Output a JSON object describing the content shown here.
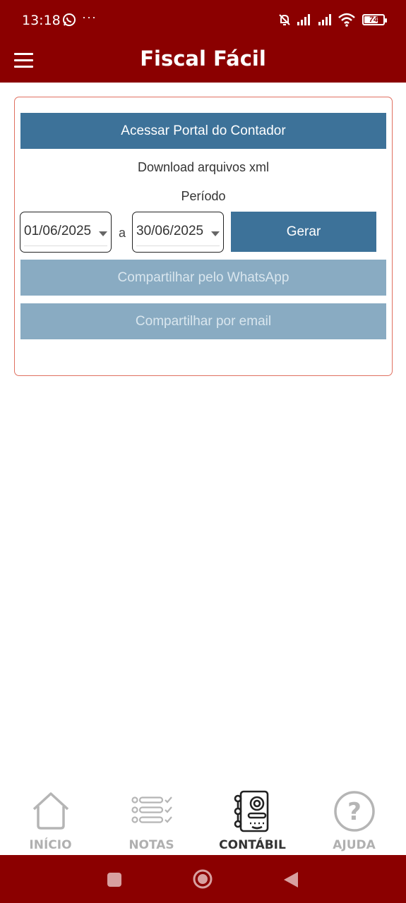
{
  "status_bar": {
    "time": "13:18",
    "dots": "···",
    "battery_level": 74,
    "battery_text": "74",
    "icons": [
      "whatsapp-icon",
      "bell-off-icon",
      "signal-icon",
      "signal-icon",
      "wifi-icon",
      "battery-icon"
    ]
  },
  "app_bar": {
    "title": "Fiscal Fácil",
    "menu_icon": "hamburger-menu-icon"
  },
  "card": {
    "portal_button": "Acessar Portal do Contador",
    "download_text": "Download arquivos xml",
    "period_label": "Período",
    "date_start": "01/06/2025",
    "date_separator": "a",
    "date_end": "30/06/2025",
    "generate_button": "Gerar",
    "share_whatsapp_button": "Compartilhar pelo WhatsApp",
    "share_email_button": "Compartilhar por email"
  },
  "bottom_nav": {
    "items": [
      {
        "label": "INÍCIO",
        "icon": "home-icon",
        "active": false
      },
      {
        "label": "NOTAS",
        "icon": "checklist-icon",
        "active": false
      },
      {
        "label": "CONTÁBIL",
        "icon": "ledger-icon",
        "active": true
      },
      {
        "label": "AJUDA",
        "icon": "help-icon",
        "active": false
      }
    ]
  },
  "colors": {
    "brand": "#8b0000",
    "primary_button": "#3d7299",
    "disabled_button": "#89abc2",
    "card_border": "#e07060"
  }
}
